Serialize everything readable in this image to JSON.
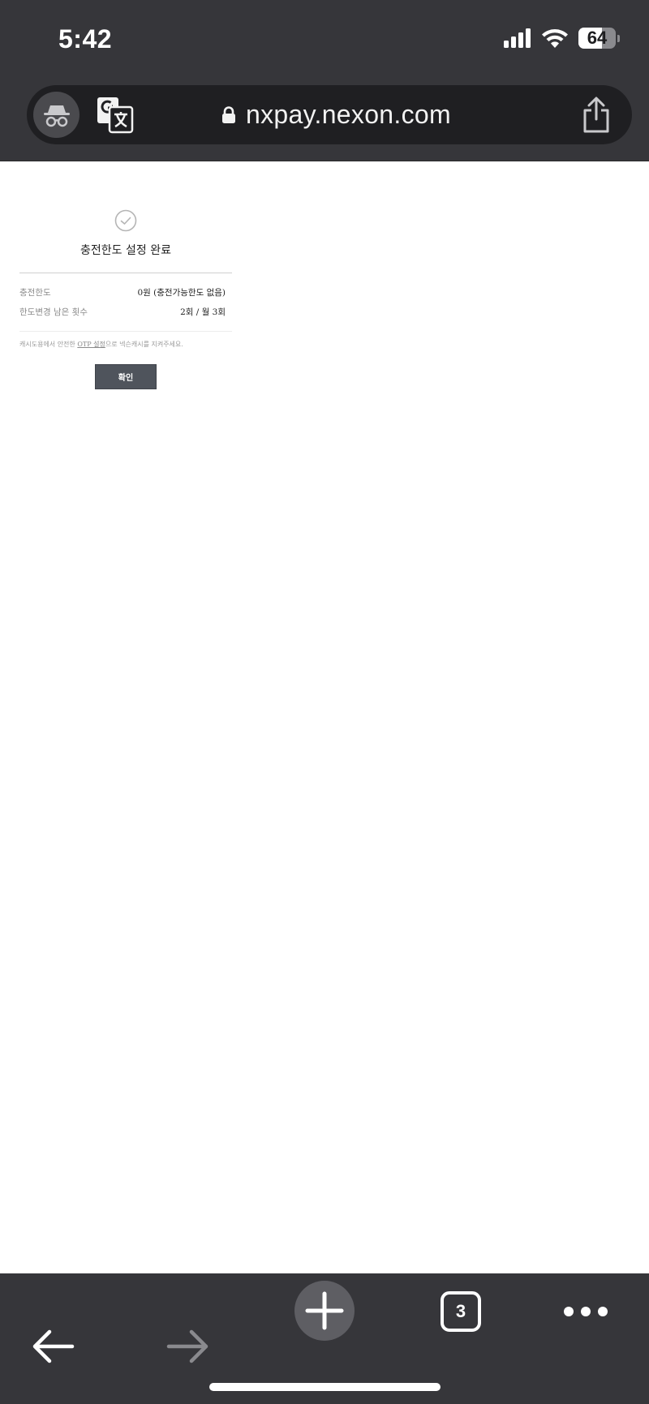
{
  "status_bar": {
    "time": "5:42",
    "battery_percent": "64",
    "battery_level": 0.64,
    "icons": [
      "cellular-signal-icon",
      "wifi-icon",
      "battery-icon"
    ]
  },
  "browser": {
    "url": "nxpay.nexon.com",
    "icons": [
      "incognito-icon",
      "translate-icon",
      "lock-icon",
      "share-icon"
    ]
  },
  "page": {
    "title": "충전한도 설정 완료",
    "rows": [
      {
        "label": "충전한도",
        "value": "0원 (충전가능한도 없음)"
      },
      {
        "label": "한도변경 남은 횟수",
        "value": "2회 / 월 3회"
      }
    ],
    "notice_prefix": "캐시도용에서 안전한 ",
    "notice_link": "OTP 설정",
    "notice_suffix": "으로 넥슨캐시를 지켜주세요.",
    "confirm_label": "확인",
    "colors": {
      "button_bg": "#4f545c",
      "check_color": "#b5b5b5"
    }
  },
  "toolbar": {
    "tab_count": "3",
    "icons": [
      "back-arrow-icon",
      "forward-arrow-icon",
      "plus-icon",
      "tabs-icon",
      "more-icon"
    ]
  }
}
